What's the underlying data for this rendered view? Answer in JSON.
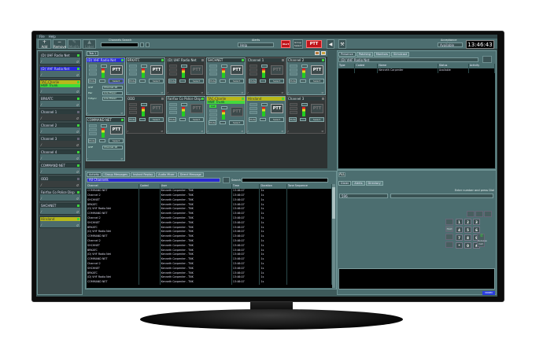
{
  "menu": [
    "File",
    "Help"
  ],
  "toolbar": {
    "add": "Add",
    "remove": "Remove",
    "modify": "Modify",
    "label": "Label",
    "channels_search_label": "Channels Search",
    "alerts_label": "Alerts",
    "alerts_value": "Help",
    "alert_button": "Alert",
    "group_select_button": "Group Select",
    "ptt_button": "PTT",
    "status_label": "Acceptance",
    "status_value": "Available",
    "clock": "13:46:43"
  },
  "left_channels": [
    {
      "name": "(D) UHF Radio Net",
      "style": "",
      "led": "on"
    },
    {
      "name": "(D) VHF Radio Net",
      "style": "blue",
      "led": "on"
    },
    {
      "name": "TAC-Charlie",
      "style": "yellow",
      "sub": "HWF Trunk",
      "led": "on"
    },
    {
      "name": "BRKATC",
      "style": "",
      "led": "on"
    },
    {
      "name": "Channel 1",
      "style": "",
      "led": "off",
      "dark": true
    },
    {
      "name": "Channel 2",
      "style": "",
      "led": "on"
    },
    {
      "name": "Channel 3",
      "style": "",
      "led": "off",
      "dark": true
    },
    {
      "name": "Channel 4",
      "style": "",
      "led": "on"
    },
    {
      "name": "COMMAND NET",
      "style": "",
      "led": "on"
    },
    {
      "name": "ODD",
      "style": "",
      "led": "off",
      "dark": true
    },
    {
      "name": "Fairfax Co Police Disp",
      "style": "",
      "led": "on"
    },
    {
      "name": "SHCHNET",
      "style": "",
      "led": "on"
    },
    {
      "name": "Hinsland",
      "style": "yellow",
      "led": "on"
    }
  ],
  "main_tab": "Tab 1",
  "tile_labels": {
    "mute": "Mute",
    "select": "Select",
    "ptt": "PTT",
    "call": "Call"
  },
  "tiles": [
    {
      "name": "(D) VHF Radio Net",
      "style": "blue",
      "active": true,
      "controls": [
        [
          "UHF",
          "Channel 16"
        ],
        [
          "Pwr",
          "Low Power"
        ],
        [
          "TxSync",
          "Low Power"
        ]
      ]
    },
    {
      "name": "BRKATC",
      "active": true
    },
    {
      "name": "(D) UHF Radio Net",
      "active": false
    },
    {
      "name": "SHCHNET",
      "active": true
    },
    {
      "name": "Channel 1",
      "active": false
    },
    {
      "name": "Channel 2",
      "active": true
    },
    {
      "name": "COMMAND NET",
      "active": true,
      "controls": [
        [
          "UHF",
          "Channel 16"
        ]
      ]
    },
    {
      "name": "ODD",
      "active": false
    },
    {
      "name": "Fairfax Co Police Disp",
      "active": true,
      "dimptt": true
    },
    {
      "name": "TAC-Charlie",
      "style": "yellow",
      "sub": "HWF Trunk",
      "call": true,
      "active": true,
      "dimptt": true
    },
    {
      "name": "Hinsland",
      "style": "yellow",
      "active": true
    },
    {
      "name": "Channel 3",
      "active": false
    }
  ],
  "activity": {
    "tabs": [
      "Activity",
      "Group Messages",
      "Instant Replay",
      "Audio Mixer",
      "Direct Message"
    ],
    "filter": "All Channels",
    "search_label": "Search",
    "columns": [
      "Channel",
      "Coded",
      "User",
      "Time",
      "Duration",
      "Tone Sequence"
    ],
    "rows": [
      [
        "COMMAND NET",
        "",
        "Kenneth Carpenter - TNK",
        "13:46:07",
        "1s",
        ""
      ],
      [
        "Channel 2",
        "",
        "Kenneth Carpenter - TNK",
        "13:46:07",
        "1s",
        ""
      ],
      [
        "SHCHNET",
        "",
        "Kenneth Carpenter - TNK",
        "13:46:07",
        "1s",
        ""
      ],
      [
        "BRKATC",
        "",
        "Kenneth Carpenter - TNK",
        "13:46:07",
        "1s",
        ""
      ],
      [
        "(D) VHF Radio Net",
        "",
        "Kenneth Carpenter - TNK",
        "13:46:07",
        "1s",
        ""
      ],
      [
        "COMMAND NET",
        "",
        "Kenneth Carpenter - TNK",
        "13:46:07",
        "1s",
        ""
      ],
      [
        "Channel 2",
        "",
        "Kenneth Carpenter - TNK",
        "13:46:07",
        "1s",
        ""
      ],
      [
        "SHCHNET",
        "",
        "Kenneth Carpenter - TNK",
        "13:46:07",
        "1s",
        ""
      ],
      [
        "BRKATC",
        "",
        "Kenneth Carpenter - TNK",
        "13:46:07",
        "1s",
        ""
      ],
      [
        "(D) VHF Radio Net",
        "",
        "Kenneth Carpenter - TNK",
        "13:46:07",
        "1s",
        ""
      ],
      [
        "COMMAND NET",
        "",
        "Kenneth Carpenter - TNK",
        "13:46:07",
        "1s",
        ""
      ],
      [
        "Channel 2",
        "",
        "Kenneth Carpenter - TNK",
        "13:46:07",
        "1s",
        ""
      ],
      [
        "SHCHNET",
        "",
        "Kenneth Carpenter - TNK",
        "13:46:07",
        "1s",
        ""
      ],
      [
        "BRKATC",
        "",
        "Kenneth Carpenter - TNK",
        "13:46:07",
        "1s",
        ""
      ],
      [
        "(D) VHF Radio Net",
        "",
        "Kenneth Carpenter - TNK",
        "13:46:07",
        "1s",
        ""
      ],
      [
        "COMMAND NET",
        "",
        "Kenneth Carpenter - TNK",
        "13:46:07",
        "1s",
        ""
      ],
      [
        "Channel 2",
        "",
        "Kenneth Carpenter - TNK",
        "13:46:07",
        "1s",
        ""
      ],
      [
        "SHCHNET",
        "",
        "Kenneth Carpenter - TNK",
        "13:46:07",
        "1s",
        ""
      ],
      [
        "BRKATC",
        "",
        "Kenneth Carpenter - TNK",
        "13:46:07",
        "1s",
        ""
      ],
      [
        "(D) VHF Radio Net",
        "",
        "Kenneth Carpenter - TNK",
        "13:46:07",
        "1s",
        ""
      ],
      [
        "COMMAND NET",
        "",
        "Kenneth Carpenter - TNK",
        "13:46:07",
        "1s",
        ""
      ]
    ]
  },
  "presence": {
    "tabs": [
      "Presence",
      "Patching",
      "Monitors",
      "Simulcast"
    ],
    "channel": "(D) VHF Radio Net",
    "columns": [
      "Type",
      "Coded",
      "Name",
      "Status",
      "Activity"
    ],
    "rows": [
      [
        "",
        "",
        "Kenneth Carpenter",
        "Available",
        ""
      ]
    ]
  },
  "dialer": {
    "all_button": "ALL",
    "tabs": [
      "Dialer",
      "Alerts",
      "Directory"
    ],
    "hint": "Enter number and press Dial",
    "line": "596",
    "keys": [
      "1",
      "2",
      "3",
      "4",
      "5",
      "6",
      "7",
      "8",
      "9",
      "*",
      "0",
      "#"
    ],
    "hold": "Hold",
    "release": "Release Call",
    "status_badge": "NORM"
  }
}
